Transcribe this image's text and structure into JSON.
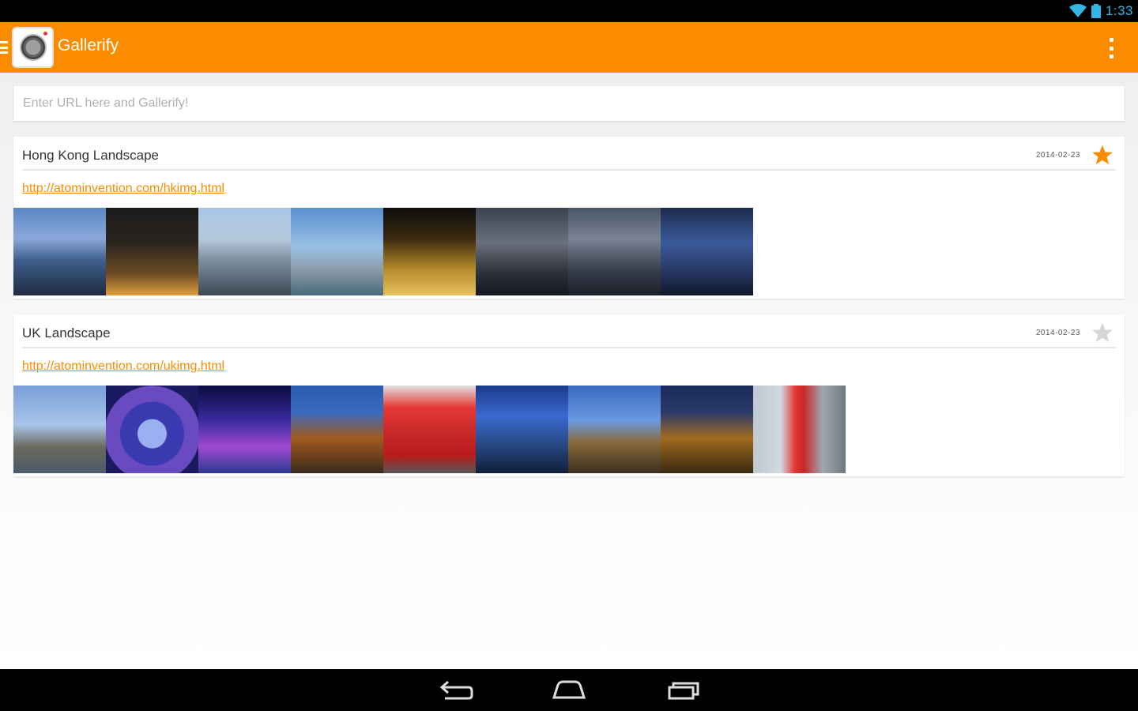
{
  "status_bar": {
    "time": "1:33",
    "icons": [
      "wifi-icon",
      "battery-icon"
    ],
    "icon_color": "#33b5e5"
  },
  "action_bar": {
    "title": "Gallerify",
    "color": "#fb8c00",
    "icons": [
      "drawer-icon",
      "app-logo-camera-icon",
      "overflow-menu-icon"
    ]
  },
  "url_input": {
    "value": "",
    "placeholder": "Enter URL here and Gallerify!"
  },
  "galleries": [
    {
      "title": "Hong Kong Landscape",
      "date": "2014-02-23",
      "starred": true,
      "url": "http://atominvention.com/hkimg.html",
      "thumbnail_count": 8
    },
    {
      "title": "UK Landscape",
      "date": "2014-02-23",
      "starred": false,
      "url": "http://atominvention.com/ukimg.html",
      "thumbnail_count": 9
    }
  ],
  "star_colors": {
    "on": "#fb8c00",
    "off": "#d6d6d6"
  },
  "nav_bar": {
    "buttons": [
      "back-icon",
      "home-icon",
      "recents-icon"
    ]
  }
}
